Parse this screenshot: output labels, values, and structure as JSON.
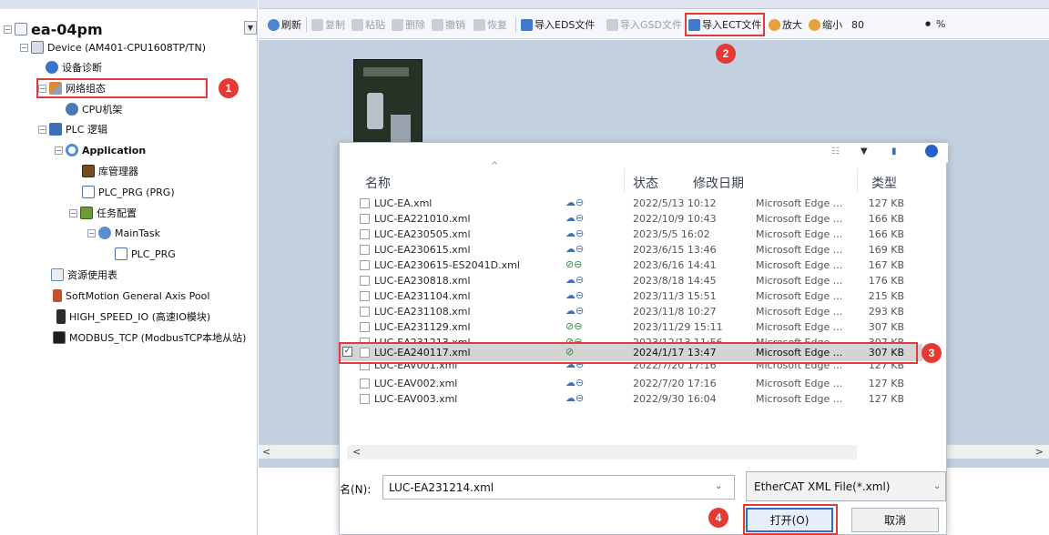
{
  "tree": {
    "project_label": "ea-04pm",
    "device_label": "Device (AM401-CPU1608TP/TN)",
    "diag_label": "设备诊断",
    "network_label": "网络组态",
    "cpu_rack_label": "CPU机架",
    "plc_logic_label": "PLC 逻辑",
    "application_label": "Application",
    "library_label": "库管理器",
    "plc_prg_label": "PLC_PRG (PRG)",
    "task_config_label": "任务配置",
    "main_task_label": "MainTask",
    "main_task_prg_label": "PLC_PRG",
    "resource_label": "资源使用表",
    "axis_pool_label": "SoftMotion General Axis Pool",
    "high_speed_label": "HIGH_SPEED_IO (高速IO模块)",
    "modbus_label": "MODBUS_TCP (ModbusTCP本地从站)"
  },
  "toolbar": {
    "refresh": "刷新",
    "copy": "复制",
    "paste": "粘贴",
    "delete": "删除",
    "undo": "撤销",
    "redo": "恢复",
    "import_eds": "导入EDS文件",
    "import_gsd": "导入GSD文件",
    "import_ect": "导入ECT文件",
    "zoom_in": "放大",
    "zoom_out": "缩小",
    "zoom_value": "80",
    "zoom_unit": "%"
  },
  "dialog": {
    "columns": {
      "name": "名称",
      "status": "状态",
      "modified": "修改日期",
      "type": "类型"
    },
    "files": [
      {
        "name": "LUC-EA.xml",
        "status": "☁⊖",
        "date": "2022/5/13 10:12",
        "type": "Microsoft Edge ...",
        "size": "127 KB"
      },
      {
        "name": "LUC-EA221010.xml",
        "status": "☁⊖",
        "date": "2022/10/9 10:43",
        "type": "Microsoft Edge ...",
        "size": "166 KB"
      },
      {
        "name": "LUC-EA230505.xml",
        "status": "☁⊖",
        "date": "2023/5/5 16:02",
        "type": "Microsoft Edge ...",
        "size": "166 KB"
      },
      {
        "name": "LUC-EA230615.xml",
        "status": "☁⊖",
        "date": "2023/6/15 13:46",
        "type": "Microsoft Edge ...",
        "size": "169 KB"
      },
      {
        "name": "LUC-EA230615-ES2041D.xml",
        "status": "⊘⊖",
        "date": "2023/6/16 14:41",
        "type": "Microsoft Edge ...",
        "size": "167 KB"
      },
      {
        "name": "LUC-EA230818.xml",
        "status": "☁⊖",
        "date": "2023/8/18 14:45",
        "type": "Microsoft Edge ...",
        "size": "176 KB"
      },
      {
        "name": "LUC-EA231104.xml",
        "status": "☁⊖",
        "date": "2023/11/3 15:51",
        "type": "Microsoft Edge ...",
        "size": "215 KB"
      },
      {
        "name": "LUC-EA231108.xml",
        "status": "☁⊖",
        "date": "2023/11/8 10:27",
        "type": "Microsoft Edge ...",
        "size": "293 KB"
      },
      {
        "name": "LUC-EA231129.xml",
        "status": "⊘⊖",
        "date": "2023/11/29 15:11",
        "type": "Microsoft Edge ...",
        "size": "307 KB"
      },
      {
        "name": "LUC-EA231213.xml",
        "status": "⊘⊖",
        "date": "2023/12/13 11:56",
        "type": "Microsoft Edge ...",
        "size": "307 KB"
      },
      {
        "name": "LUC-EA240117.xml",
        "status": "⊘",
        "date": "2024/1/17 13:47",
        "type": "Microsoft Edge ...",
        "size": "307 KB"
      },
      {
        "name": "LUC-EAV001.xml",
        "status": "☁⊖",
        "date": "2022/7/20 17:16",
        "type": "Microsoft Edge ...",
        "size": "127 KB"
      },
      {
        "name": "LUC-EAV002.xml",
        "status": "☁⊖",
        "date": "2022/7/20 17:16",
        "type": "Microsoft Edge ...",
        "size": "127 KB"
      },
      {
        "name": "LUC-EAV003.xml",
        "status": "☁⊖",
        "date": "2022/9/30 16:04",
        "type": "Microsoft Edge ...",
        "size": "127 KB"
      }
    ],
    "filename_label": "名(N):",
    "filename_value": "LUC-EA231214.xml",
    "filter_value": "EtherCAT XML File(*.xml)",
    "open_label": "打开(O)",
    "cancel_label": "取消"
  },
  "annotations": {
    "step1": "1",
    "step2": "2",
    "step3": "3",
    "step4": "4"
  },
  "colors": {
    "highlight": "#e33b3b",
    "badge": "#e53935",
    "workspace_bg": "#c3d0e0",
    "selected_row": "#d4d4d4"
  }
}
